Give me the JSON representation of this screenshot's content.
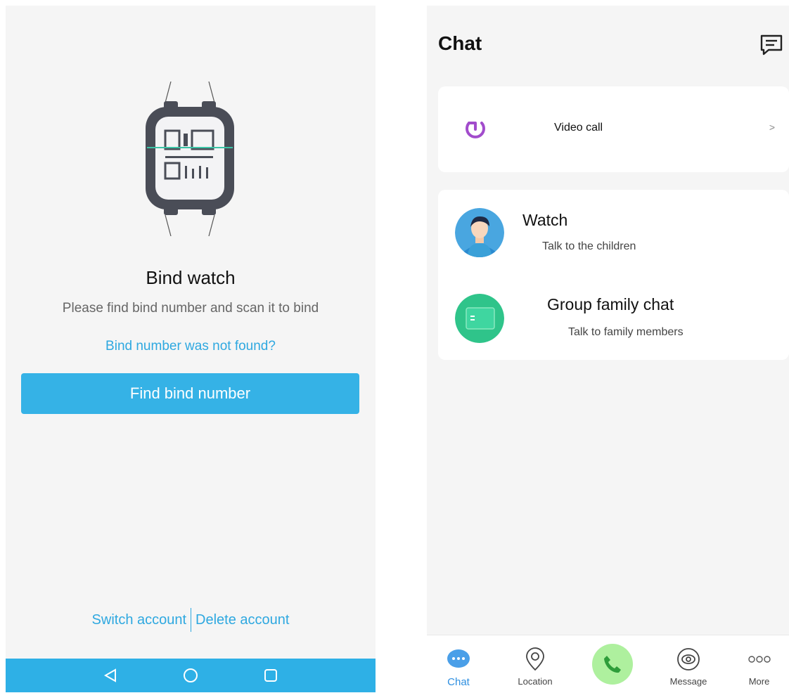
{
  "bind_screen": {
    "title": "Bind watch",
    "description": "Please find bind number and scan it to bind",
    "not_found_link": "Bind number was not found?",
    "find_button": "Find bind number",
    "switch_account": "Switch account",
    "delete_account": "Delete account",
    "accent_color": "#35b2e6",
    "nav_icons": [
      "back-icon",
      "home-icon",
      "recents-icon"
    ]
  },
  "chat_screen": {
    "title": "Chat",
    "video_call": {
      "label": "Video call",
      "chevron": ">"
    },
    "contacts": [
      {
        "name": "Watch",
        "subtitle": "Talk to the children"
      },
      {
        "name": "Group family chat",
        "subtitle": "Talk to family members"
      }
    ],
    "tabs": [
      {
        "label": "Chat",
        "icon": "chat-bubble-icon",
        "active": true
      },
      {
        "label": "Location",
        "icon": "location-pin-icon",
        "active": false
      },
      {
        "label": "",
        "icon": "phone-icon",
        "active": false
      },
      {
        "label": "Message",
        "icon": "eye-icon",
        "active": false
      },
      {
        "label": "More",
        "icon": "more-dots-icon",
        "active": false
      }
    ],
    "active_color": "#2e8fe0"
  }
}
